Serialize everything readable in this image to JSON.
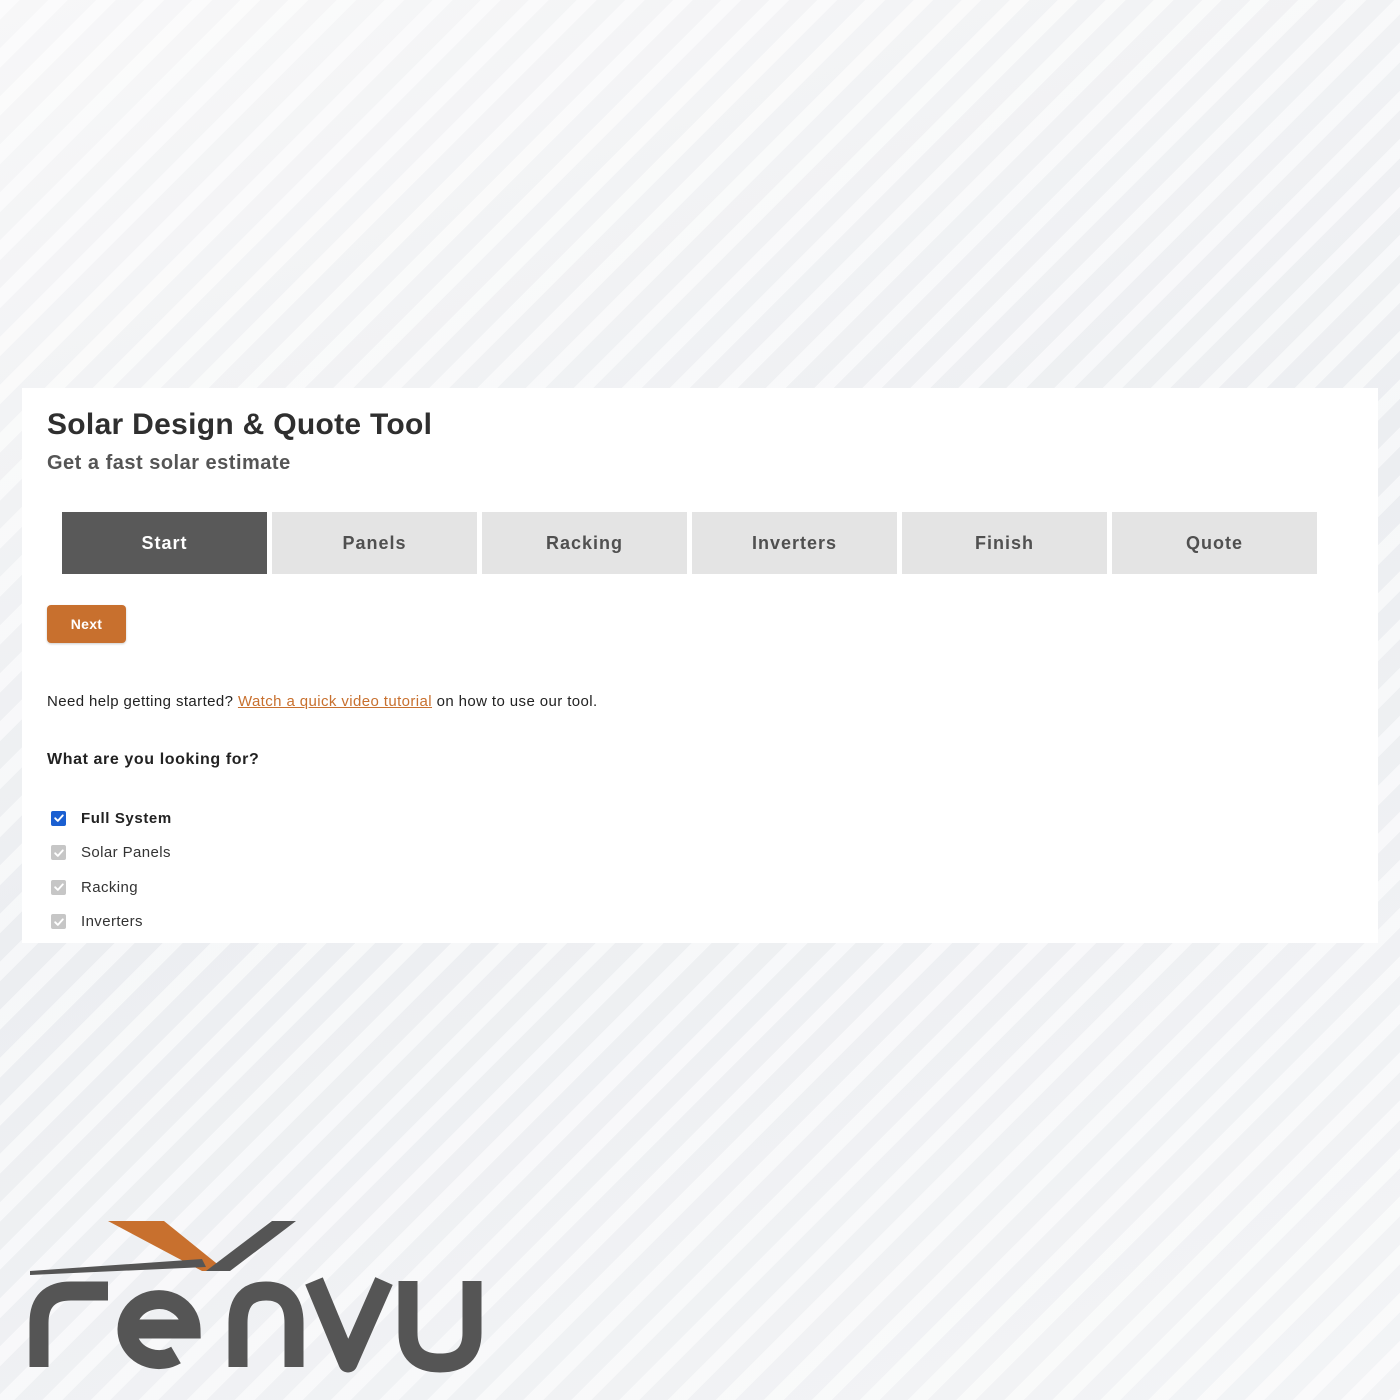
{
  "header": {
    "title": "Solar Design & Quote Tool",
    "subtitle": "Get a fast solar estimate"
  },
  "tabs": [
    {
      "label": "Start",
      "active": true
    },
    {
      "label": "Panels",
      "active": false
    },
    {
      "label": "Racking",
      "active": false
    },
    {
      "label": "Inverters",
      "active": false
    },
    {
      "label": "Finish",
      "active": false
    },
    {
      "label": "Quote",
      "active": false
    }
  ],
  "next_button": {
    "label": "Next"
  },
  "help": {
    "prefix": "Need help getting started?",
    "link_text": "Watch a quick video tutorial",
    "suffix": "on how to use our tool."
  },
  "question": {
    "label": "What are you looking for?"
  },
  "options": [
    {
      "label": "Full System",
      "checked": true,
      "disabled": false
    },
    {
      "label": "Solar Panels",
      "checked": true,
      "disabled": true
    },
    {
      "label": "Racking",
      "checked": true,
      "disabled": true
    },
    {
      "label": "Inverters",
      "checked": true,
      "disabled": true
    }
  ],
  "logo": {
    "text": "renvu"
  },
  "colors": {
    "accent": "#c8702e",
    "tab_active": "#595959",
    "tab_inactive": "#e4e4e4",
    "checkbox_checked": "#1a5fd1",
    "checkbox_disabled": "#c6c6c6",
    "logo_gray": "#555555"
  },
  "icons": {
    "checkbox": "checkmark-icon",
    "logo_mark": "renvu-chevron-logo"
  }
}
